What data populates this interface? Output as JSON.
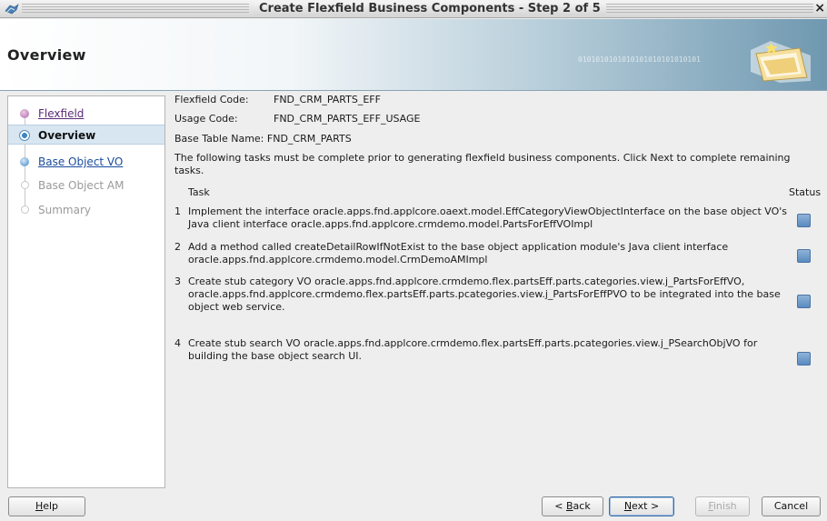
{
  "window": {
    "title": "Create Flexfield Business Components - Step 2 of 5",
    "close": "×"
  },
  "banner": {
    "heading": "Overview",
    "binary_pattern": "0101010101010101010101010101"
  },
  "nav": {
    "items": [
      {
        "label": "Flexfield",
        "state": "visited"
      },
      {
        "label": "Overview",
        "state": "current"
      },
      {
        "label": "Base Object VO",
        "state": "link"
      },
      {
        "label": "Base Object AM",
        "state": "disabled"
      },
      {
        "label": "Summary",
        "state": "disabled"
      }
    ]
  },
  "fields": {
    "flexfield_code_label": "Flexfield Code:",
    "flexfield_code": "FND_CRM_PARTS_EFF",
    "usage_code_label": "Usage Code:",
    "usage_code": "FND_CRM_PARTS_EFF_USAGE",
    "base_table_label": "Base Table Name:",
    "base_table": "FND_CRM_PARTS"
  },
  "intro": "The following tasks must be complete prior to generating flexfield business components. Click Next to complete remaining tasks.",
  "tasks_table": {
    "task_header": "Task",
    "status_header": "Status",
    "rows": [
      {
        "num": "1",
        "text": "Implement the interface oracle.apps.fnd.applcore.oaext.model.EffCategoryViewObjectInterface on the base object VO's Java client interface oracle.apps.fnd.applcore.crmdemo.model.PartsForEffVOImpl"
      },
      {
        "num": "2",
        "text": "Add a method called createDetailRowIfNotExist to the base object application module's Java client interface oracle.apps.fnd.applcore.crmdemo.model.CrmDemoAMImpl"
      },
      {
        "num": "3",
        "text": "Create stub category VO oracle.apps.fnd.applcore.crmdemo.flex.partsEff.parts.categories.view.j_PartsForEffVO, oracle.apps.fnd.applcore.crmdemo.flex.partsEff.parts.pcategories.view.j_PartsForEffPVO to be integrated into the base object web service."
      },
      {
        "num": "4",
        "text": "Create stub search VO oracle.apps.fnd.applcore.crmdemo.flex.partsEff.parts.pcategories.view.j_PSearchObjVO for building the base object search UI."
      }
    ]
  },
  "buttons": {
    "help": {
      "label": "Help",
      "mnemonic": "H",
      "rest": "elp"
    },
    "back": {
      "pre": "< ",
      "mnemonic": "B",
      "rest": "ack"
    },
    "next": {
      "mnemonic": "N",
      "rest": "ext >"
    },
    "finish": {
      "mnemonic": "F",
      "rest": "inish"
    },
    "cancel": {
      "label": "Cancel"
    }
  },
  "colors": {
    "accent": "#3f86c4",
    "status_box": "#6d9bcb",
    "nav_selected": "#d8e6f1"
  }
}
